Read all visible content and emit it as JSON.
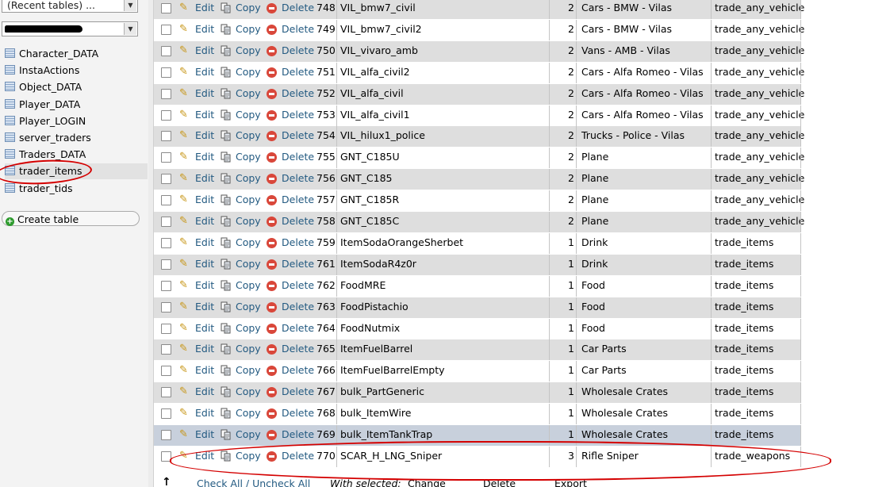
{
  "sidebar": {
    "recent_tables": "(Recent tables) ...",
    "tables": [
      {
        "label": "Character_DATA"
      },
      {
        "label": "InstaActions"
      },
      {
        "label": "Object_DATA"
      },
      {
        "label": "Player_DATA"
      },
      {
        "label": "Player_LOGIN"
      },
      {
        "label": "server_traders"
      },
      {
        "label": "Traders_DATA"
      },
      {
        "label": "trader_items"
      },
      {
        "label": "trader_tids"
      }
    ],
    "create_table": "Create table"
  },
  "actions": {
    "edit": "Edit",
    "copy": "Copy",
    "delete": "Delete"
  },
  "rows": [
    {
      "id": "748",
      "name": "VIL_bmw7_civil",
      "qty": "2",
      "category": "Cars - BMW - Vilas",
      "type": "trade_any_vehicle"
    },
    {
      "id": "749",
      "name": "VIL_bmw7_civil2",
      "qty": "2",
      "category": "Cars - BMW - Vilas",
      "type": "trade_any_vehicle"
    },
    {
      "id": "750",
      "name": "VIL_vivaro_amb",
      "qty": "2",
      "category": "Vans - AMB - Vilas",
      "type": "trade_any_vehicle"
    },
    {
      "id": "751",
      "name": "VIL_alfa_civil2",
      "qty": "2",
      "category": "Cars - Alfa Romeo - Vilas",
      "type": "trade_any_vehicle"
    },
    {
      "id": "752",
      "name": "VIL_alfa_civil",
      "qty": "2",
      "category": "Cars - Alfa Romeo - Vilas",
      "type": "trade_any_vehicle"
    },
    {
      "id": "753",
      "name": "VIL_alfa_civil1",
      "qty": "2",
      "category": "Cars - Alfa Romeo - Vilas",
      "type": "trade_any_vehicle"
    },
    {
      "id": "754",
      "name": "VIL_hilux1_police",
      "qty": "2",
      "category": "Trucks - Police - Vilas",
      "type": "trade_any_vehicle"
    },
    {
      "id": "755",
      "name": "GNT_C185U",
      "qty": "2",
      "category": "Plane",
      "type": "trade_any_vehicle"
    },
    {
      "id": "756",
      "name": "GNT_C185",
      "qty": "2",
      "category": "Plane",
      "type": "trade_any_vehicle"
    },
    {
      "id": "757",
      "name": "GNT_C185R",
      "qty": "2",
      "category": "Plane",
      "type": "trade_any_vehicle"
    },
    {
      "id": "758",
      "name": "GNT_C185C",
      "qty": "2",
      "category": "Plane",
      "type": "trade_any_vehicle"
    },
    {
      "id": "759",
      "name": "ItemSodaOrangeSherbet",
      "qty": "1",
      "category": "Drink",
      "type": "trade_items"
    },
    {
      "id": "761",
      "name": "ItemSodaR4z0r",
      "qty": "1",
      "category": "Drink",
      "type": "trade_items"
    },
    {
      "id": "762",
      "name": "FoodMRE",
      "qty": "1",
      "category": "Food",
      "type": "trade_items"
    },
    {
      "id": "763",
      "name": "FoodPistachio",
      "qty": "1",
      "category": "Food",
      "type": "trade_items"
    },
    {
      "id": "764",
      "name": "FoodNutmix",
      "qty": "1",
      "category": "Food",
      "type": "trade_items"
    },
    {
      "id": "765",
      "name": "ItemFuelBarrel",
      "qty": "1",
      "category": "Car Parts",
      "type": "trade_items"
    },
    {
      "id": "766",
      "name": "ItemFuelBarrelEmpty",
      "qty": "1",
      "category": "Car Parts",
      "type": "trade_items"
    },
    {
      "id": "767",
      "name": "bulk_PartGeneric",
      "qty": "1",
      "category": "Wholesale Crates",
      "type": "trade_items"
    },
    {
      "id": "768",
      "name": "bulk_ItemWire",
      "qty": "1",
      "category": "Wholesale Crates",
      "type": "trade_items"
    },
    {
      "id": "769",
      "name": "bulk_ItemTankTrap",
      "qty": "1",
      "category": "Wholesale Crates",
      "type": "trade_items"
    },
    {
      "id": "770",
      "name": "SCAR_H_LNG_Sniper",
      "qty": "3",
      "category": "Rifle Sniper",
      "type": "trade_weapons"
    }
  ],
  "bottom": {
    "check_all": "Check All / Uncheck All",
    "with_selected": "With selected:",
    "change": "Change",
    "delete": "Delete",
    "export": "Export"
  }
}
